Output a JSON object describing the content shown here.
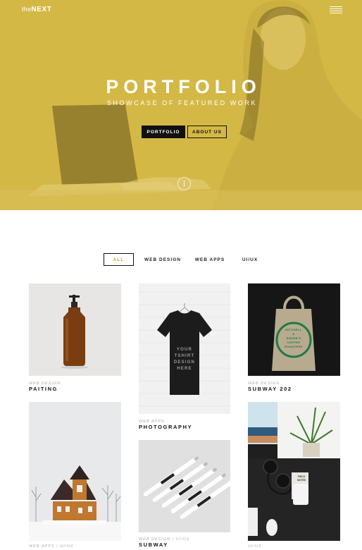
{
  "nav": {
    "brand_prefix": "the",
    "brand_name": "NEXT",
    "menu_icon": "hamburger-menu-icon"
  },
  "hero": {
    "title": "PORTFOLIO",
    "subtitle": "SHOWCASE OF FEATURED WORK",
    "primary_button": "PORTFOLIO",
    "secondary_button": "ABOUT US",
    "overlay_color": "#d4b845",
    "scroll_icon": "scroll-down-icon"
  },
  "filters": [
    {
      "label": "ALL",
      "active": true
    },
    {
      "label": "WEB DESIGN",
      "active": false
    },
    {
      "label": "WEB APPS",
      "active": false
    },
    {
      "label": "UI/UX",
      "active": false
    }
  ],
  "portfolio": [
    {
      "category": "WEB DESIGN",
      "title": "PAITING",
      "image": "amber-pump-bottle"
    },
    {
      "category": "WEB APPS",
      "title": "PHOTOGRAPHY",
      "image": "black-tshirt-mockup",
      "image_text": [
        "YOUR",
        "TSHIRT",
        "DESIGN",
        "HERE"
      ]
    },
    {
      "category": "WEB DESIGN",
      "title": "SUBWAY 202",
      "image": "tote-bag-mockup",
      "image_text": [
        "MITCHELL",
        "&",
        "ANDRE'S",
        "COFFEE",
        "ROASTERS"
      ]
    },
    {
      "category": "WEB APPS / UI/UX",
      "title": "",
      "image": "snowy-house"
    },
    {
      "category": "WEB DESIGN / UI/UX",
      "title": "SUBWAY",
      "image": "pens-pattern"
    },
    {
      "category": "UI/UX",
      "title": "",
      "image": "desk-flatlay",
      "image_text": [
        "FIELD",
        "NOTES"
      ]
    }
  ],
  "colors": {
    "accent": "#d4a316",
    "dark": "#111111"
  }
}
